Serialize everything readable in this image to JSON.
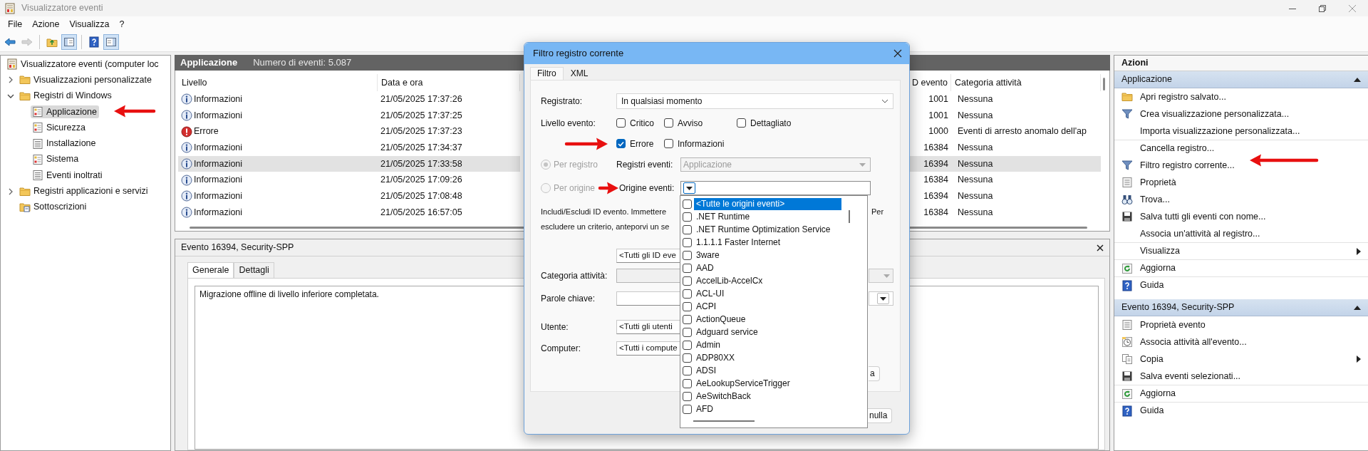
{
  "window": {
    "title": "Visualizzatore eventi"
  },
  "menu": [
    "File",
    "Azione",
    "Visualizza",
    "?"
  ],
  "toolbar": [
    {
      "kind": "back",
      "disabled": false,
      "pressed": false
    },
    {
      "kind": "forward",
      "disabled": true,
      "pressed": false
    },
    {
      "kind": "separator"
    },
    {
      "kind": "up",
      "disabled": false,
      "pressed": false
    },
    {
      "kind": "tree",
      "disabled": false,
      "pressed": true
    },
    {
      "kind": "separator"
    },
    {
      "kind": "help",
      "disabled": false,
      "pressed": false
    },
    {
      "kind": "pane",
      "disabled": false,
      "pressed": true
    }
  ],
  "tree": [
    {
      "kind": "root",
      "label": "Visualizzatore eventi (computer loc",
      "selected": false,
      "children": [
        {
          "kind": "folder",
          "label": "Visualizzazioni personalizzate",
          "expanded": false,
          "selected": false
        },
        {
          "kind": "folder",
          "label": "Registri di Windows",
          "expanded": true,
          "selected": false,
          "children": [
            {
              "kind": "log",
              "label": "Applicazione",
              "selected": true
            },
            {
              "kind": "log",
              "label": "Sicurezza",
              "selected": false
            },
            {
              "kind": "list",
              "label": "Installazione",
              "selected": false
            },
            {
              "kind": "log",
              "label": "Sistema",
              "selected": false
            },
            {
              "kind": "list",
              "label": "Eventi inoltrati",
              "selected": false
            }
          ]
        },
        {
          "kind": "folder",
          "label": "Registri applicazioni e servizi",
          "expanded": false,
          "selected": false
        },
        {
          "kind": "subscriptions",
          "label": "Sottoscrizioni",
          "selected": false
        }
      ]
    }
  ],
  "log_header": {
    "title": "Applicazione",
    "count": "Numero di eventi: 5.087"
  },
  "table": {
    "columns": [
      "Livello",
      "Data e ora",
      "D evento",
      "Categoria attività"
    ],
    "rows": [
      {
        "kind": "info",
        "level": "Informazioni",
        "date": "21/05/2025 17:37:26",
        "id": "1001",
        "category": "Nessuna",
        "selected": false
      },
      {
        "kind": "info",
        "level": "Informazioni",
        "date": "21/05/2025 17:37:25",
        "id": "1001",
        "category": "Nessuna",
        "selected": false
      },
      {
        "kind": "error",
        "level": "Errore",
        "date": "21/05/2025 17:37:23",
        "id": "1000",
        "category": "Eventi di arresto anomalo dell'ap",
        "selected": false
      },
      {
        "kind": "info",
        "level": "Informazioni",
        "date": "21/05/2025 17:34:37",
        "id": "16384",
        "category": "Nessuna",
        "selected": false
      },
      {
        "kind": "info",
        "level": "Informazioni",
        "date": "21/05/2025 17:33:58",
        "id": "16394",
        "category": "Nessuna",
        "selected": true
      },
      {
        "kind": "info",
        "level": "Informazioni",
        "date": "21/05/2025 17:09:26",
        "id": "16384",
        "category": "Nessuna",
        "selected": false
      },
      {
        "kind": "info",
        "level": "Informazioni",
        "date": "21/05/2025 17:08:48",
        "id": "16394",
        "category": "Nessuna",
        "selected": false
      },
      {
        "kind": "info",
        "level": "Informazioni",
        "date": "21/05/2025 16:57:05",
        "id": "16384",
        "category": "Nessuna",
        "selected": false
      }
    ]
  },
  "event_detail": {
    "title": "Evento 16394, Security-SPP",
    "tabs": [
      {
        "label": "Generale",
        "selected": true
      },
      {
        "label": "Dettagli",
        "selected": false
      }
    ],
    "message": "Migrazione offline di livello inferiore completata."
  },
  "actions": {
    "title": "Azioni",
    "sections": [
      {
        "title": "Applicazione",
        "expanded": true,
        "items": [
          {
            "kind": "folder",
            "label": "Apri registro salvato...",
            "separator_before": false,
            "submenu": false
          },
          {
            "kind": "filter",
            "label": "Crea visualizzazione personalizzata...",
            "separator_before": false,
            "submenu": false
          },
          {
            "kind": "none",
            "label": "Importa visualizzazione personalizzata...",
            "separator_before": false,
            "submenu": false
          },
          {
            "kind": "none",
            "label": "Cancella registro...",
            "separator_before": true,
            "submenu": false
          },
          {
            "kind": "filter",
            "label": "Filtro registro corrente...",
            "separator_before": false,
            "submenu": false
          },
          {
            "kind": "properties",
            "label": "Proprietà",
            "separator_before": false,
            "submenu": false
          },
          {
            "kind": "find",
            "label": "Trova...",
            "separator_before": false,
            "submenu": false
          },
          {
            "kind": "save",
            "label": "Salva tutti gli eventi con nome...",
            "separator_before": false,
            "submenu": false
          },
          {
            "kind": "none",
            "label": "Associa un'attività al registro...",
            "separator_before": false,
            "submenu": false
          },
          {
            "kind": "none",
            "label": "Visualizza",
            "separator_before": true,
            "submenu": true
          },
          {
            "kind": "refresh",
            "label": "Aggiorna",
            "separator_before": true,
            "submenu": false
          },
          {
            "kind": "help",
            "label": "Guida",
            "separator_before": true,
            "submenu": false
          }
        ]
      },
      {
        "title": "Evento 16394, Security-SPP",
        "expanded": true,
        "items": [
          {
            "kind": "properties",
            "label": "Proprietà evento",
            "separator_before": false,
            "submenu": false
          },
          {
            "kind": "task",
            "label": "Associa attività all'evento...",
            "separator_before": false,
            "submenu": false
          },
          {
            "kind": "copy",
            "label": "Copia",
            "separator_before": false,
            "submenu": true
          },
          {
            "kind": "save",
            "label": "Salva eventi selezionati...",
            "separator_before": false,
            "submenu": false
          },
          {
            "kind": "refresh",
            "label": "Aggiorna",
            "separator_before": true,
            "submenu": false
          },
          {
            "kind": "help",
            "label": "Guida",
            "separator_before": true,
            "submenu": false
          }
        ]
      }
    ]
  },
  "dialog": {
    "title": "Filtro registro corrente",
    "tabs": [
      {
        "label": "Filtro",
        "selected": true
      },
      {
        "label": "XML",
        "selected": false
      }
    ],
    "logged": {
      "label": "Registrato:",
      "value": "In qualsiasi momento"
    },
    "level_label": "Livello evento:",
    "levels": [
      {
        "label": "Critico",
        "checked": false
      },
      {
        "label": "Avviso",
        "checked": false
      },
      {
        "label": "Dettagliato",
        "checked": false
      },
      {
        "label": "Errore",
        "checked": true
      },
      {
        "label": "Informazioni",
        "checked": false
      }
    ],
    "scope": [
      {
        "label": "Per registro",
        "selected": true,
        "disabled": true,
        "field_label": "Registri eventi:",
        "value": "Applicazione"
      },
      {
        "label": "Per origine",
        "selected": false,
        "disabled": true,
        "field_label": "Origine eventi:"
      }
    ],
    "description_left": [
      "Includi/Escludi ID evento. Immettere",
      "escludere un criterio, anteporvi un se"
    ],
    "description_right": "Per",
    "fields": [
      {
        "kind": "text",
        "value": "<Tutti gli ID eve",
        "disabled": false
      },
      {
        "kind": "combo",
        "label": "Categoria attività:",
        "disabled": true
      },
      {
        "kind": "combo",
        "label": "Parole chiave:",
        "disabled": false
      },
      {
        "kind": "text",
        "label": "Utente:",
        "value": "<Tutti gli utenti",
        "disabled": false
      },
      {
        "kind": "text",
        "label": "Computer:",
        "value": "<Tutti i compute",
        "disabled": false
      }
    ],
    "buttons": [
      {
        "label": "a"
      },
      {
        "label": "nulla"
      }
    ],
    "sources": [
      {
        "label": "<Tutte le origini eventi>",
        "checked": false,
        "selected": true
      },
      {
        "label": ".NET Runtime",
        "checked": false,
        "selected": false
      },
      {
        "label": ".NET Runtime Optimization Service",
        "checked": false,
        "selected": false
      },
      {
        "label": "1.1.1.1 Faster Internet",
        "checked": false,
        "selected": false
      },
      {
        "label": "3ware",
        "checked": false,
        "selected": false
      },
      {
        "label": "AAD",
        "checked": false,
        "selected": false
      },
      {
        "label": "AccelLib-AccelCx",
        "checked": false,
        "selected": false
      },
      {
        "label": "ACL-UI",
        "checked": false,
        "selected": false
      },
      {
        "label": "ACPI",
        "checked": false,
        "selected": false
      },
      {
        "label": "ActionQueue",
        "checked": false,
        "selected": false
      },
      {
        "label": "Adguard service",
        "checked": false,
        "selected": false
      },
      {
        "label": "Admin",
        "checked": false,
        "selected": false
      },
      {
        "label": "ADP80XX",
        "checked": false,
        "selected": false
      },
      {
        "label": "ADSI",
        "checked": false,
        "selected": false
      },
      {
        "label": "AeLookupServiceTrigger",
        "checked": false,
        "selected": false
      },
      {
        "label": "AeSwitchBack",
        "checked": false,
        "selected": false
      },
      {
        "label": "AFD",
        "checked": false,
        "selected": false
      }
    ]
  }
}
